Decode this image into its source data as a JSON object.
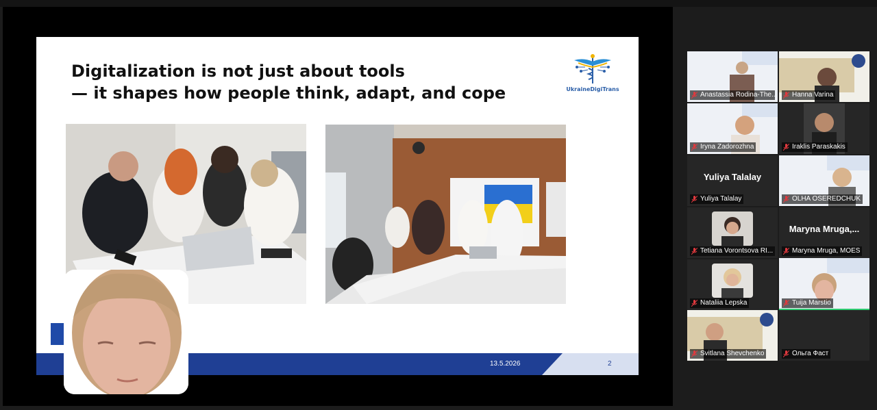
{
  "slide": {
    "title_line1": "Digitalization is not just about tools",
    "title_line2": "— it shapes how people think, adapt, and cope",
    "logo_text": "UkraineDigiTrans",
    "date": "13.5.2026",
    "page": "2"
  },
  "participants": [
    {
      "name": "Anastassia Rodina-The...",
      "muted": true
    },
    {
      "name": "Hanna Varina",
      "muted": true
    },
    {
      "name": "Iryna Zadorozhna",
      "muted": true
    },
    {
      "name": "Iraklis Paraskakis",
      "muted": true
    },
    {
      "name": "Yuliya Talalay",
      "muted": true,
      "display_name": "Yuliya Talalay"
    },
    {
      "name": "OLHA OSEREDCHUK",
      "muted": true
    },
    {
      "name": "Tetiana Vorontsova RI...",
      "muted": true
    },
    {
      "name": "Maryna Mruga, MOES",
      "muted": true,
      "display_name": "Maryna  Mruga,..."
    },
    {
      "name": "Nataliia Lepska",
      "muted": true
    },
    {
      "name": "Tuija Marstio",
      "muted": true,
      "active": true
    },
    {
      "name": "Svitlana Shevchenko",
      "muted": true
    },
    {
      "name": "Ольга Фаст",
      "muted": true
    }
  ],
  "colors": {
    "slide_footer": "#1f3f94",
    "active_speaker": "#2ecc71",
    "muted_icon": "#e0393e"
  }
}
